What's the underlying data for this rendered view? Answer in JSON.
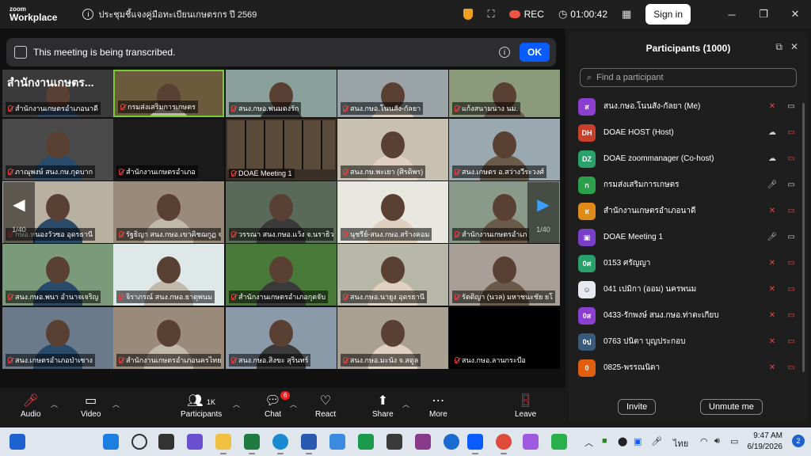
{
  "titlebar": {
    "logo_line1": "zoom",
    "logo_line2": "Workplace",
    "meeting_title": "ประชุมชี้แจงคู่มือทะเบียนเกษตรกร ปี 2569",
    "rec_label": "REC",
    "timer": "01:00:42",
    "signin_label": "Sign in"
  },
  "banner": {
    "text": "This meeting is being transcribed.",
    "ok_label": "OK"
  },
  "gallery": {
    "page_left": "1/40",
    "page_right": "1/40",
    "office_title": "สำนักงานเกษตร...",
    "tiles": [
      {
        "label": "สำนักงานเกษตรอำเภอนาดี",
        "color": "#3a3a3a"
      },
      {
        "label": "กรมส่งเสริมการเกษตร",
        "color": "#6b5a3c"
      },
      {
        "label": "สนง.กษอ.พนมดงรัก",
        "color": "#8aa09a"
      },
      {
        "label": "สนง.กษอ.โนนสัง-กัลยา",
        "color": "#9aa4a8"
      },
      {
        "label": "แก้งสนามนาง นม.",
        "color": "#8a9a7a"
      },
      {
        "label": "ภาณุพงษ์ สนง.กษ.กุดบาก",
        "color": "#4a4a4a"
      },
      {
        "label": "สำนักงานเกษตรอำเภอ",
        "color": "#1a1a1a"
      },
      {
        "label": "DOAE Meeting 1",
        "color": "#3a3028"
      },
      {
        "label": "สนง.กษ.พะเยา (ศิรดิพร)",
        "color": "#c8c0b0"
      },
      {
        "label": "สนง.เกษตร อ.สว่างวีระวงศ์",
        "color": "#9aa8b0"
      },
      {
        "label": "กษอ.หนองวัวซอ อุดรธานี",
        "color": "#b8b0a0"
      },
      {
        "label": "รัฐธิญา สนง.กษอ.เขาคิชฌกูฏ จ.",
        "color": "#9a8a7a"
      },
      {
        "label": "วรรณา สนง.กษอ.แว้ง จ.นราธิวา",
        "color": "#5a6a5a"
      },
      {
        "label": "นุชรีย์-สนง.กษอ.สร้างคอม",
        "color": "#e8e8e0"
      },
      {
        "label": "สำนักงานเกษตรอำเภ",
        "color": "#8a9a8a"
      },
      {
        "label": "สนง.กษอ.พนา อำนาจเจริญ",
        "color": "#7a9a7a"
      },
      {
        "label": "จิราภรณ์ สนง.กษอ.ธาตุพนม",
        "color": "#dfe8e8"
      },
      {
        "label": "สำนักงานเกษตรอำเภอกุดจับ",
        "color": "#4a7a3a"
      },
      {
        "label": "สนง.กษอ.นายูง อุดรธานี",
        "color": "#b8b8a8"
      },
      {
        "label": "รัตติญา (นวล) มหาชนะชัย ยโ",
        "color": "#a8a098"
      },
      {
        "label": "สนง.เกษตรอำเภอป่าเซาง",
        "color": "#6a7a8a"
      },
      {
        "label": "สำนักงานเกษตรอำเภอนครไทย",
        "color": "#9a8a7a"
      },
      {
        "label": "สนง.กษอ.สิงขะ สุรินทร์",
        "color": "#8a9aa8"
      },
      {
        "label": "สนง.กษอ.มะนัง จ.สตูล",
        "color": "#a8a090"
      },
      {
        "label": "สนง.กษอ.ลานกระบือ",
        "color": "#000000"
      }
    ]
  },
  "toolbar": {
    "audio": "Audio",
    "video": "Video",
    "participants": "Participants",
    "participants_count": "1K",
    "chat": "Chat",
    "chat_badge": "6",
    "react": "React",
    "share": "Share",
    "more": "More",
    "leave": "Leave"
  },
  "panel": {
    "title": "Participants (1000)",
    "search_placeholder": "Find a participant",
    "participants": [
      {
        "initials": "ส",
        "name": "สนง.กษอ.โนนสัง-กัลยา (Me)",
        "color": "#8a3fd1",
        "mic": "off",
        "cam": "on"
      },
      {
        "initials": "DH",
        "name": "DOAE HOST (Host)",
        "color": "#c8402a",
        "mic": "cloud",
        "cam": "off"
      },
      {
        "initials": "DZ",
        "name": "DOAE zoommanager (Co-host)",
        "color": "#2aa06a",
        "mic": "cloud",
        "cam": "off"
      },
      {
        "initials": "ก",
        "name": "กรมส่งเสริมการเกษตร",
        "color": "#2aa04a",
        "mic": "on",
        "cam": "on"
      },
      {
        "initials": "ส",
        "name": "สำนักงานเกษตรอำเภอนาดี",
        "color": "#e08a1a",
        "mic": "off",
        "cam": "off"
      },
      {
        "initials": "▣",
        "name": "DOAE Meeting 1",
        "color": "#7a3fc8",
        "mic": "on",
        "cam": "on"
      },
      {
        "initials": "0ศ",
        "name": "0153 ศรัญญา",
        "color": "#2aa06a",
        "mic": "off",
        "cam": "off"
      },
      {
        "initials": "☺",
        "name": "041 เปมิกา (ออม) นครพนม",
        "color": "#e8e8f0",
        "mic": "off",
        "cam": "off"
      },
      {
        "initials": "0ส",
        "name": "0433-รักพงษ์ สนง.กษอ.ท่าตะเกียบ",
        "color": "#8a3fd1",
        "mic": "off",
        "cam": "off"
      },
      {
        "initials": "0ป",
        "name": "0763 ปนิตา บุญประกอบ",
        "color": "#3a5a7a",
        "mic": "off",
        "cam": "off"
      },
      {
        "initials": "0",
        "name": "0825-พรรณนิดา",
        "color": "#e06010",
        "mic": "off",
        "cam": "off"
      }
    ],
    "invite_label": "Invite",
    "unmute_label": "Unmute me"
  },
  "taskbar": {
    "lang": "ไทย",
    "time": "9:47 AM",
    "date": "6/19/2026",
    "notifications": "2"
  }
}
